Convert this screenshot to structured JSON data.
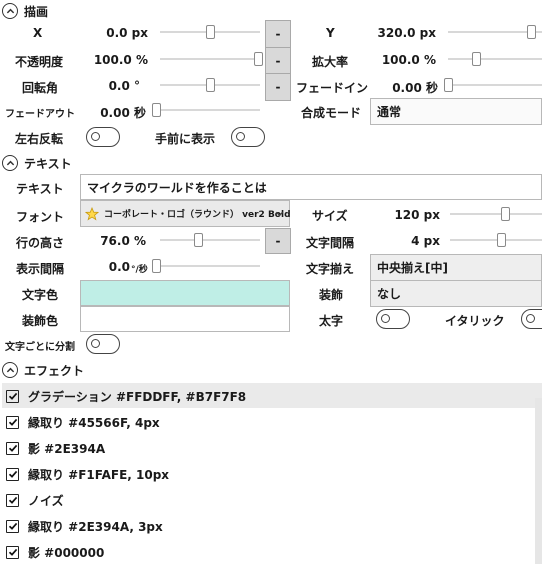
{
  "sections": {
    "drawing": "描画",
    "text": "テキスト",
    "effects": "エフェクト"
  },
  "drawing": {
    "x_label": "X",
    "x_value": "0.0 px",
    "x_slider": 0.5,
    "y_label": "Y",
    "y_value": "320.0 px",
    "y_slider": 0.88,
    "opacity_label": "不透明度",
    "opacity_value": "100.0 %",
    "opacity_slider": 0.98,
    "scale_label": "拡大率",
    "scale_value": "100.0 %",
    "scale_slider": 0.3,
    "rotation_label": "回転角",
    "rotation_value": "0.0 °",
    "rotation_slider": 0.5,
    "fadein_label": "フェードイン",
    "fadein_value": "0.00 秒",
    "fadein_slider": 0.0,
    "fadeout_label": "フェードアウト",
    "fadeout_value": "0.00 秒",
    "fadeout_slider": 0.0,
    "blend_label": "合成モード",
    "blend_value": "通常",
    "flip_label": "左右反転",
    "front_label": "手前に表示",
    "minus": "-"
  },
  "text": {
    "text_label": "テキスト",
    "text_value": "マイクラのワールドを作ることは",
    "font_label": "フォント",
    "font_value": "コーポレート・ロゴ（ラウンド） ver2 Bold",
    "size_label": "サイズ",
    "size_value": "120 px",
    "size_slider": 0.6,
    "line_height_label": "行の高さ",
    "line_height_value": "76.0 %",
    "line_height_slider": 0.38,
    "char_spacing_label": "文字間隔",
    "char_spacing_value": "4 px",
    "char_spacing_slider": 0.55,
    "display_interval_label": "表示間隔",
    "display_interval_value": "0.0 ",
    "display_interval_unit": "°/秒",
    "display_interval_slider": 0.0,
    "align_label": "文字揃え",
    "align_value": "中央揃え[中]",
    "text_color_label": "文字色",
    "text_color": "#BFEEE6",
    "decoration_label": "装飾",
    "decoration_value": "なし",
    "decoration_color_label": "装飾色",
    "decoration_color": "#FFFFFF",
    "bold_label": "太字",
    "italic_label": "イタリック",
    "split_label": "文字ごとに分割",
    "minus": "-"
  },
  "effects": [
    {
      "label": "グラデーション #FFDDFF, #B7F7F8",
      "checked": true
    },
    {
      "label": "縁取り #45566F, 4px",
      "checked": true
    },
    {
      "label": "影 #2E394A",
      "checked": true
    },
    {
      "label": "縁取り #F1FAFE, 10px",
      "checked": true
    },
    {
      "label": "ノイズ",
      "checked": true
    },
    {
      "label": "縁取り #2E394A, 3px",
      "checked": true
    },
    {
      "label": "影 #000000",
      "checked": true
    }
  ]
}
